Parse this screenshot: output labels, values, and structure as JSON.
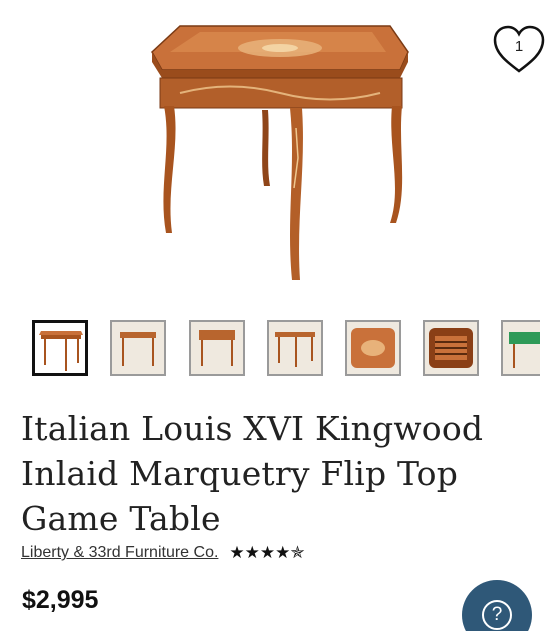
{
  "product": {
    "title": "Italian Louis XVI Kingwood Inlaid Marquetry Flip Top Game Table",
    "seller": "Liberty & 33rd Furniture Co.",
    "rating_stars": "★★★★✯",
    "rating": 4.5,
    "price": "$2,995"
  },
  "favorite": {
    "count": "1",
    "icon": "heart-outline-icon"
  },
  "gallery": {
    "selected_index": 0,
    "thumbnail_count_visible": 7
  },
  "help_button": {
    "label": "?",
    "icon": "question-circle-icon",
    "color": "#2f5878"
  },
  "colors": {
    "wood": "#b8652e",
    "wood_dark": "#8a4418",
    "text": "#222222"
  }
}
